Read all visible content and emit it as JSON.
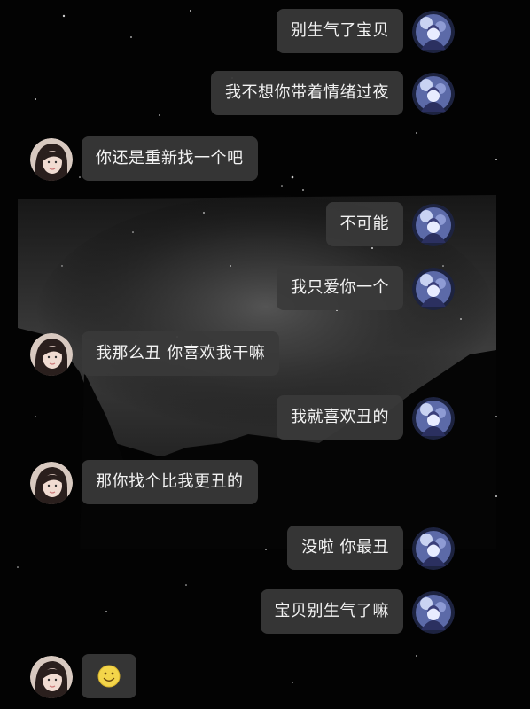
{
  "chat": {
    "messages": [
      {
        "sender": "self",
        "text": "别生气了宝贝"
      },
      {
        "sender": "self",
        "text": "我不想你带着情绪过夜"
      },
      {
        "sender": "other",
        "text": "你还是重新找一个吧"
      },
      {
        "sender": "self",
        "text": "不可能"
      },
      {
        "sender": "self",
        "text": "我只爱你一个"
      },
      {
        "sender": "other",
        "text": "我那么丑 你喜欢我干嘛"
      },
      {
        "sender": "self",
        "text": "我就喜欢丑的"
      },
      {
        "sender": "other",
        "text": "那你找个比我更丑的"
      },
      {
        "sender": "self",
        "text": "没啦 你最丑"
      },
      {
        "sender": "self",
        "text": "宝贝别生气了嘛"
      },
      {
        "sender": "other",
        "emoji": "smiley-emoji"
      }
    ]
  },
  "colors": {
    "background": "#030303",
    "bubble": "#3a3a3a",
    "text": "#f2f2f2",
    "emoji": "#f3d54a"
  }
}
